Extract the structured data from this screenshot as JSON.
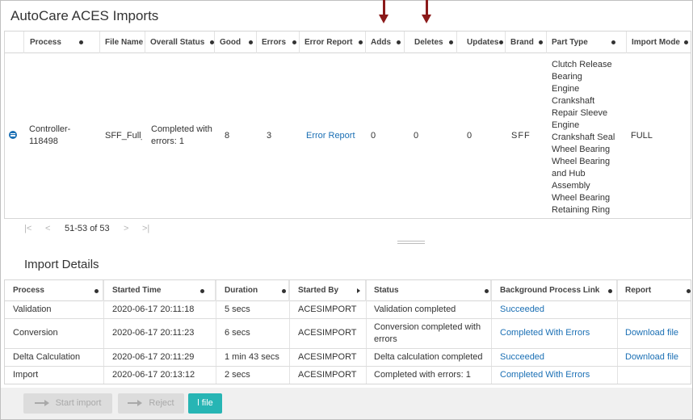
{
  "page_title": "AutoCare ACES Imports",
  "imports_table": {
    "columns": [
      "Process",
      "File Name",
      "Overall Status",
      "Good",
      "Errors",
      "Error Report",
      "Adds",
      "Deletes",
      "Updates",
      "Brand",
      "Part Type",
      "Import Mode"
    ],
    "row": {
      "process_line1": "Controller-",
      "process_line2": "118498",
      "file_name": "SFF_Full_",
      "status_line1": "Completed with",
      "status_line2": "errors: 1",
      "good": "8",
      "errors": "3",
      "error_report": "Error Report",
      "adds": "0",
      "deletes": "0",
      "updates": "0",
      "brand": "SFF",
      "part_type_lines": [
        "Clutch Release",
        "Bearing",
        "Engine",
        "Crankshaft",
        "Repair Sleeve",
        "Engine",
        "Crankshaft Seal",
        "Wheel Bearing",
        "Wheel Bearing",
        "and Hub",
        "Assembly",
        "Wheel Bearing",
        "Retaining Ring"
      ],
      "import_mode": "FULL"
    }
  },
  "pager": {
    "first": "|<",
    "prev": "<",
    "range": "51-53 of 53",
    "next": ">",
    "last": ">|"
  },
  "details_title": "Import Details",
  "details_table": {
    "columns": [
      "Process",
      "Started Time",
      "Duration",
      "Started By",
      "Status",
      "Background Process Link",
      "Report"
    ],
    "rows": [
      {
        "process": "Validation",
        "started": "2020-06-17 20:11:18",
        "duration": "5 secs",
        "by": "ACESIMPORT",
        "status_line1": "Validation completed",
        "status_line2": "",
        "link": "Succeeded",
        "report": ""
      },
      {
        "process": "Conversion",
        "started": "2020-06-17 20:11:23",
        "duration": "6 secs",
        "by": "ACESIMPORT",
        "status_line1": "Conversion completed with",
        "status_line2": "errors",
        "link": "Completed With Errors",
        "report": "Download file"
      },
      {
        "process": "Delta Calculation",
        "started": "2020-06-17 20:11:29",
        "duration": "1 min 43 secs",
        "by": "ACESIMPORT",
        "status_line1": "Delta calculation completed",
        "status_line2": "",
        "link": "Succeeded",
        "report": "Download file"
      },
      {
        "process": "Import",
        "started": "2020-06-17 20:13:12",
        "duration": "2 secs",
        "by": "ACESIMPORT",
        "status_line1": "Completed with errors: 1",
        "status_line2": "",
        "link": "Completed With Errors",
        "report": ""
      }
    ]
  },
  "footer": {
    "start_import": "Start import",
    "reject": "Reject",
    "file": "l file"
  },
  "colors": {
    "link": "#1a6fb4",
    "arrow": "#8b1a1a",
    "teal_button": "#27b5b4"
  },
  "icons": [
    "down-arrow-icon",
    "column-menu-icon",
    "expand-row-icon",
    "first-page-icon",
    "prev-page-icon",
    "next-page-icon",
    "last-page-icon",
    "import-arrow-icon"
  ]
}
